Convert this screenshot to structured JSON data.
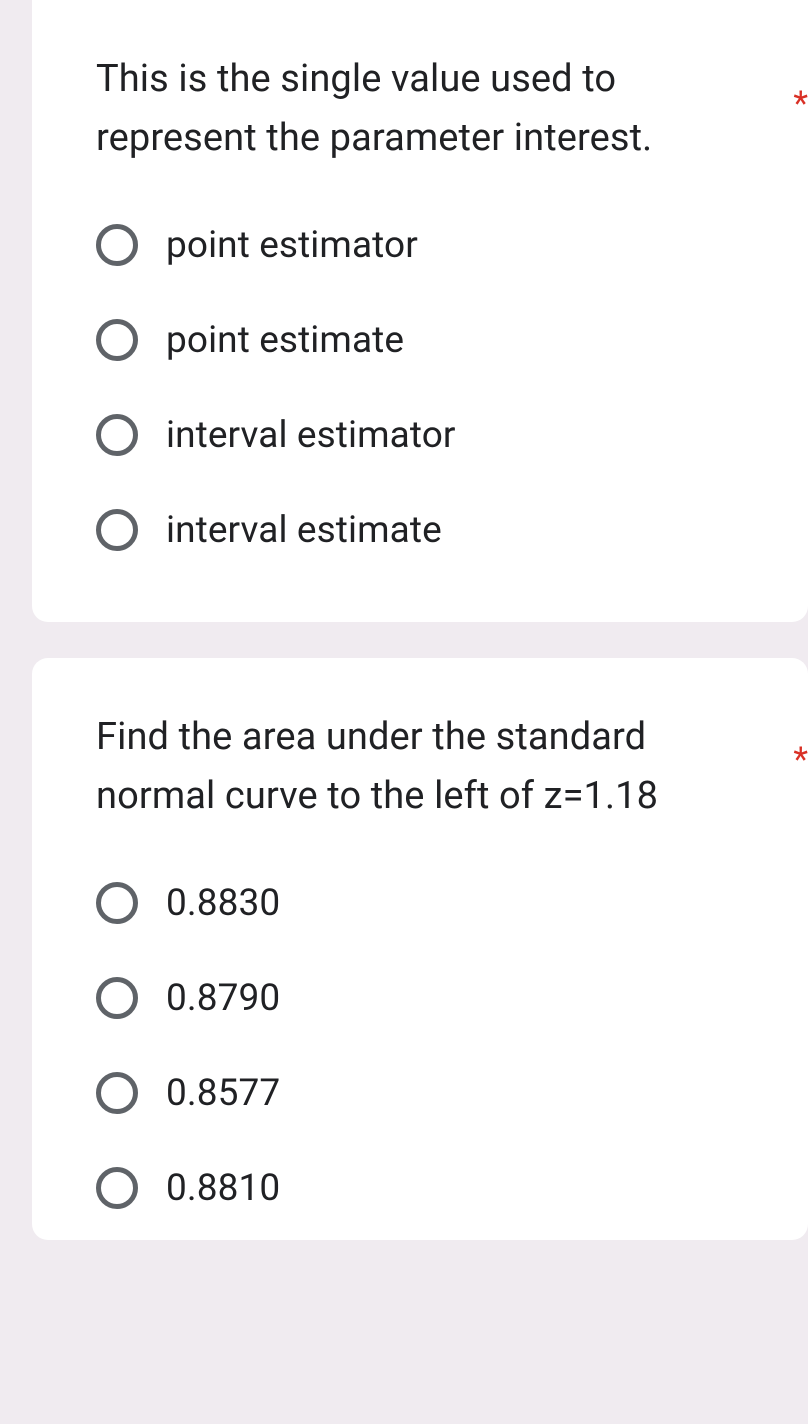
{
  "required_marker": "*",
  "questions": [
    {
      "text": "This is the single value used to represent the parameter interest.",
      "options": [
        "point estimator",
        "point estimate",
        "interval estimator",
        "interval estimate"
      ]
    },
    {
      "text": "Find the area under the standard normal curve to the left of z=1.18",
      "options": [
        "0.8830",
        "0.8790",
        "0.8577",
        "0.8810"
      ]
    }
  ]
}
